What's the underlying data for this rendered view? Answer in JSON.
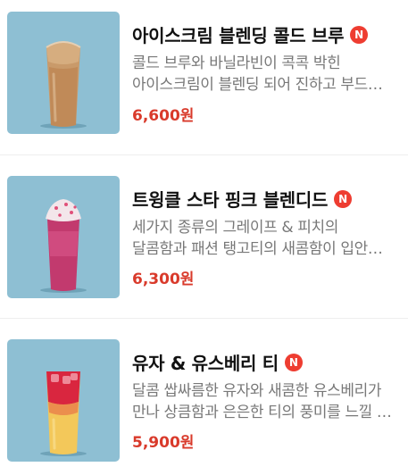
{
  "menu": {
    "items": [
      {
        "title": "아이스크림 블렌딩 콜드 브루",
        "badge": "N",
        "description": "콜드 브루와 바닐라빈이 콕콕 박힌 아이스크림이 블렌딩 되어 진하고 부드러운 맛",
        "price": "6,600원",
        "image": "drink-cold-brew-blended-image"
      },
      {
        "title": "트윙클 스타 핑크 블렌디드",
        "badge": "N",
        "description": "세가지 종류의 그레이프 & 피치의 달콤함과 패션 탱고티의 새콤함이 입안 한가득",
        "price": "6,300원",
        "image": "drink-pink-blended-image"
      },
      {
        "title": "유자 & 유스베리 티",
        "badge": "N",
        "description": "달콤 쌉싸름한 유자와 새콤한 유스베리가 만나 상큼함과 은은한 티의 풍미를 느낄 수 있는 음료",
        "price": "5,900원",
        "image": "drink-yuja-tea-image"
      }
    ],
    "colors": {
      "thumb_bg": "#8ebfd3",
      "badge": "#ee3d31",
      "price": "#d93a2b",
      "description": "#787878"
    }
  }
}
